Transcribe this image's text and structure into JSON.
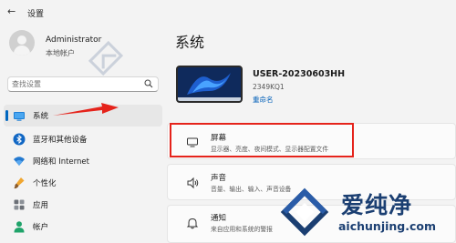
{
  "window": {
    "back_glyph": "←",
    "title": "设置"
  },
  "account": {
    "name": "Administrator",
    "type": "本地帐户"
  },
  "search": {
    "placeholder": "查找设置"
  },
  "sidebar": {
    "items": [
      {
        "label": "系统",
        "icon": "monitor-icon",
        "active": true
      },
      {
        "label": "蓝牙和其他设备",
        "icon": "bluetooth-icon"
      },
      {
        "label": "网络和 Internet",
        "icon": "wifi-icon"
      },
      {
        "label": "个性化",
        "icon": "brush-icon"
      },
      {
        "label": "应用",
        "icon": "apps-icon"
      },
      {
        "label": "帐户",
        "icon": "account-icon"
      }
    ]
  },
  "main": {
    "title": "系统",
    "device": {
      "name": "USER-20230603HH",
      "model": "2349KQ1",
      "rename_label": "重命名"
    },
    "cards": [
      {
        "title": "屏幕",
        "desc": "显示器、亮度、夜间模式、显示器配置文件",
        "icon": "display-icon"
      },
      {
        "title": "声音",
        "desc": "音量、输出、输入、声音设备",
        "icon": "speaker-icon"
      },
      {
        "title": "通知",
        "desc": "来自应用和系统的警报",
        "icon": "bell-icon"
      }
    ]
  },
  "watermark": {
    "text_cn": "爱纯净",
    "url": "aichunjing.com"
  },
  "colors": {
    "accent": "#0067c0",
    "highlight": "#e5231b",
    "watermark": "#1b3f72"
  }
}
